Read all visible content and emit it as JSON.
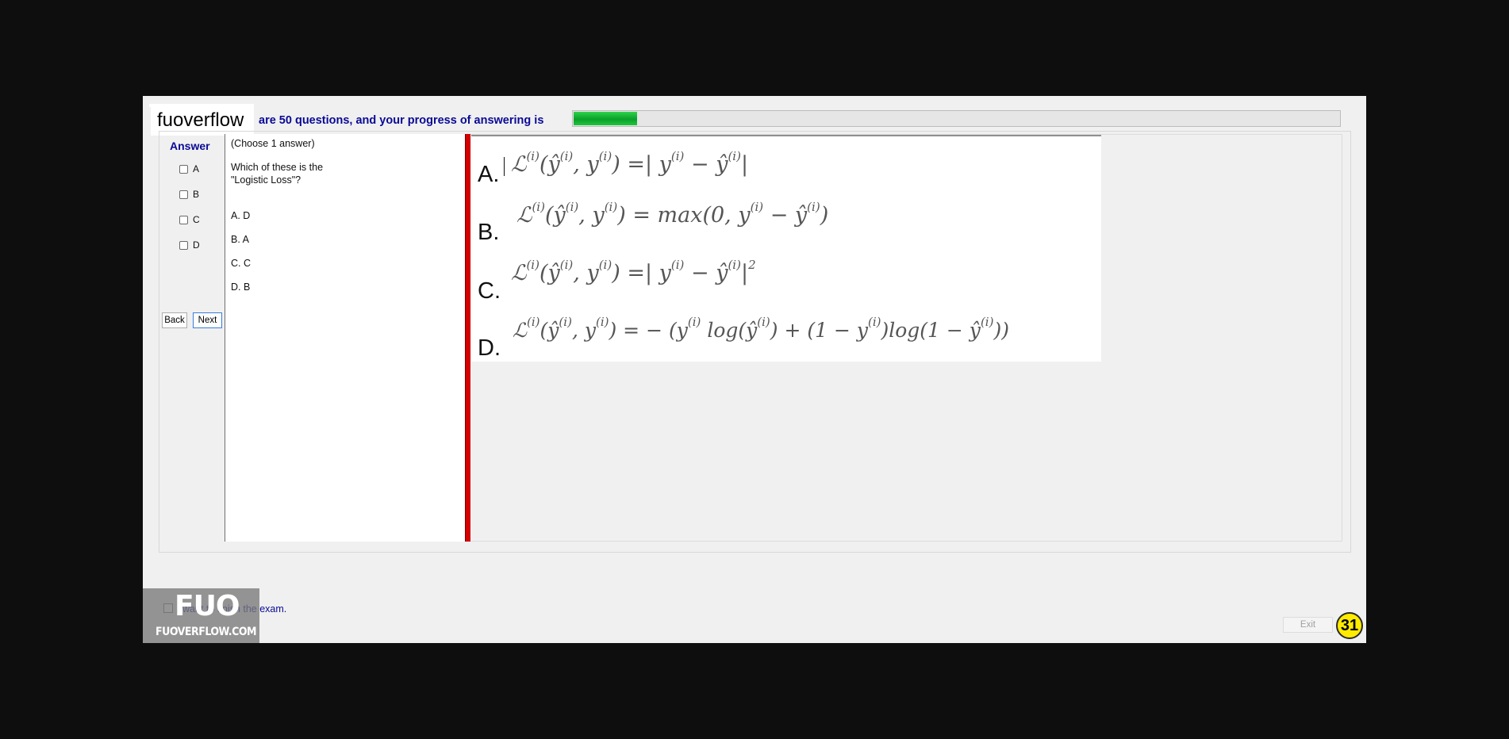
{
  "app": {
    "logo_text": "fuoverflow"
  },
  "header": {
    "progress_text": "are 50 questions, and your progress of answering is",
    "progress_value": 0.083
  },
  "answer_panel": {
    "title": "Answer",
    "options": [
      {
        "label": "A",
        "checked": false
      },
      {
        "label": "B",
        "checked": false
      },
      {
        "label": "C",
        "checked": false
      },
      {
        "label": "D",
        "checked": false
      }
    ],
    "back_label": "Back",
    "next_label": "Next"
  },
  "question": {
    "instruction": "(Choose 1 answer)",
    "text_line1": "Which of these is the",
    "text_line2": "\"Logistic Loss\"?",
    "choices": [
      "A.  D",
      "B.  A",
      "C.  C",
      "D.  B"
    ]
  },
  "formulas": [
    {
      "letter": "A.",
      "lhs": "ℒ",
      "rest_a": "(ŷ",
      "rest_b": ", y",
      "rest_c": ") =| y",
      "rest_d": " − ŷ",
      "rest_e": "|"
    },
    {
      "letter": "B.",
      "text": "(ŷ⁽ⁱ⁾, y⁽ⁱ⁾) = max(0, y⁽ⁱ⁾ − ŷ⁽ⁱ⁾)"
    },
    {
      "letter": "C.",
      "text": "(ŷ⁽ⁱ⁾, y⁽ⁱ⁾) =| y⁽ⁱ⁾ − ŷ⁽ⁱ⁾|²"
    },
    {
      "letter": "D.",
      "text": "(ŷ⁽ⁱ⁾, y⁽ⁱ⁾) = − (y⁽ⁱ⁾ log(ŷ⁽ⁱ⁾) + (1 − y⁽ⁱ⁾)log(1 − ŷ⁽ⁱ⁾))"
    }
  ],
  "footer": {
    "finish_text": "I want to finish the exam.",
    "finish_checked": false,
    "exit_label": "Exit",
    "timer": "31"
  },
  "watermark": {
    "brand": "FUO",
    "site": "FUOVERFLOW.COM"
  },
  "colors": {
    "accent_text": "#0a0a96",
    "divider": "#d40000",
    "timer_bg": "#ffeb00",
    "progress": "#1ec53b"
  }
}
